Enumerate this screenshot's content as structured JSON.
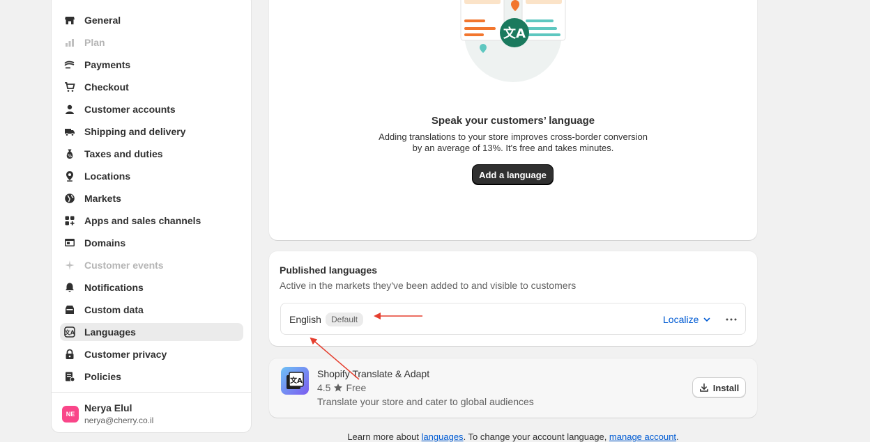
{
  "sidebar": {
    "items": [
      {
        "label": "General",
        "icon": "store-icon",
        "state": "normal"
      },
      {
        "label": "Plan",
        "icon": "plan-icon",
        "state": "disabled"
      },
      {
        "label": "Payments",
        "icon": "payments-icon",
        "state": "normal"
      },
      {
        "label": "Checkout",
        "icon": "cart-icon",
        "state": "normal"
      },
      {
        "label": "Customer accounts",
        "icon": "person-icon",
        "state": "normal"
      },
      {
        "label": "Shipping and delivery",
        "icon": "truck-icon",
        "state": "normal"
      },
      {
        "label": "Taxes and duties",
        "icon": "tax-bag-icon",
        "state": "normal"
      },
      {
        "label": "Locations",
        "icon": "location-pin-icon",
        "state": "normal"
      },
      {
        "label": "Markets",
        "icon": "globe-icon",
        "state": "normal"
      },
      {
        "label": "Apps and sales channels",
        "icon": "apps-icon",
        "state": "normal"
      },
      {
        "label": "Domains",
        "icon": "domains-icon",
        "state": "normal"
      },
      {
        "label": "Customer events",
        "icon": "sparkle-icon",
        "state": "disabled"
      },
      {
        "label": "Notifications",
        "icon": "bell-icon",
        "state": "normal"
      },
      {
        "label": "Custom data",
        "icon": "database-icon",
        "state": "normal"
      },
      {
        "label": "Languages",
        "icon": "translate-icon",
        "state": "selected"
      },
      {
        "label": "Customer privacy",
        "icon": "lock-icon",
        "state": "normal"
      },
      {
        "label": "Policies",
        "icon": "policies-icon",
        "state": "normal"
      }
    ]
  },
  "user": {
    "initials": "NE",
    "name": "Nerya Elul",
    "email": "nerya@cherry.co.il",
    "avatar_color": "#f94689"
  },
  "hero": {
    "title": "Speak your customers’ language",
    "desc_line1": "Adding translations to your store improves cross-border conversion",
    "desc_line2": "by an average of 13%. It's free and takes minutes.",
    "button": "Add a language"
  },
  "published": {
    "title": "Published languages",
    "subtitle": "Active in the markets they've been added to and visible to customers",
    "language": "English",
    "badge": "Default",
    "localize": "Localize"
  },
  "app": {
    "name": "Shopify Translate & Adapt",
    "rating": "4.5",
    "price": "Free",
    "desc": "Translate your store and cater to global audiences",
    "install": "Install"
  },
  "footer": {
    "prefix": "Learn more about ",
    "link1": "languages",
    "middle": ". To change your account language, ",
    "link2": "manage account",
    "suffix": "."
  },
  "colors": {
    "accent": "#005bd3",
    "annotation": "#e53e2e",
    "translate_badge": "#1a7a5e"
  }
}
